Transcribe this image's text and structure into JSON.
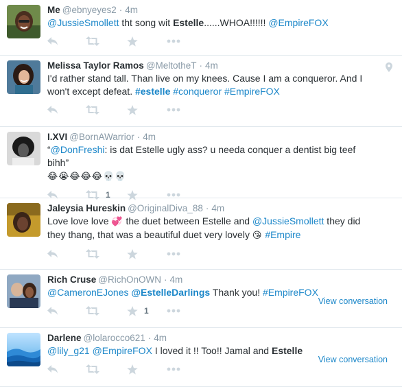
{
  "tweets": [
    {
      "fullname": "Me",
      "username": "@ebnyeyes2",
      "time": "4m",
      "parts": [
        {
          "t": "@JussieSmollett",
          "k": "mention"
        },
        {
          "t": " tht song wit "
        },
        {
          "t": "Estelle",
          "k": "bold"
        },
        {
          "t": "......WHOA!!!!!! "
        },
        {
          "t": "@EmpireFOX",
          "k": "mention"
        }
      ],
      "retweet_count": "",
      "favorite_count": "",
      "view_conversation": "",
      "avatar_icon": "user-photo"
    },
    {
      "fullname": "Melissa Taylor Ramos",
      "username": "@MeltotheT",
      "time": "4m",
      "parts": [
        {
          "t": "I'd rather stand tall.  Than live on my knees. Cause I am a conqueror. And I won't except defeat. "
        },
        {
          "t": "#estelle",
          "k": "hashtag-bold"
        },
        {
          "t": " "
        },
        {
          "t": "#conqueror",
          "k": "hashtag"
        },
        {
          "t": " "
        },
        {
          "t": "#EmpireFOX",
          "k": "hashtag"
        }
      ],
      "retweet_count": "",
      "favorite_count": "",
      "view_conversation": "",
      "avatar_icon": "user-photo",
      "geo_icon": "map-pin-icon"
    },
    {
      "fullname": "I.XVI",
      "username": "@BornAWarrior",
      "time": "4m",
      "parts": [
        {
          "t": "“"
        },
        {
          "t": "@DonFreshi",
          "k": "mention"
        },
        {
          "t": ": is dat Estelle ugly ass? u needa conquer a dentist big teef bihh”"
        },
        {
          "t": "\n"
        },
        {
          "t": "😂😭😂😂😂💀💀",
          "k": "emoji"
        }
      ],
      "retweet_count": "1",
      "favorite_count": "",
      "view_conversation": "",
      "avatar_icon": "user-photo"
    },
    {
      "fullname": "Jaleysia Hureskin",
      "username": "@OriginalDiva_88",
      "time": "4m",
      "parts": [
        {
          "t": "Love love love "
        },
        {
          "t": "💞",
          "k": "emoji"
        },
        {
          "t": " the duet between Estelle and "
        },
        {
          "t": "@JussieSmollett",
          "k": "mention"
        },
        {
          "t": " they did they thang, that was a beautiful duet very lovely "
        },
        {
          "t": "😘",
          "k": "emoji"
        },
        {
          "t": " "
        },
        {
          "t": "#Empire",
          "k": "hashtag"
        }
      ],
      "retweet_count": "",
      "favorite_count": "",
      "view_conversation": "",
      "avatar_icon": "user-photo"
    },
    {
      "fullname": "Rich Cruse",
      "username": "@RichOnOWN",
      "time": "4m",
      "parts": [
        {
          "t": "@CameronEJones",
          "k": "mention"
        },
        {
          "t": " "
        },
        {
          "t": "@EstelleDarlings",
          "k": "mention-bold"
        },
        {
          "t": " Thank you! "
        },
        {
          "t": "#EmpireFOX",
          "k": "hashtag"
        }
      ],
      "retweet_count": "",
      "favorite_count": "1",
      "view_conversation": "View conversation",
      "avatar_icon": "user-photo"
    },
    {
      "fullname": "Darlene",
      "username": "@lolarocco621",
      "time": "4m",
      "parts": [
        {
          "t": "@lily_g21",
          "k": "mention"
        },
        {
          "t": " "
        },
        {
          "t": "@EmpireFOX",
          "k": "mention"
        },
        {
          "t": " I loved it !! Too!! Jamal and "
        },
        {
          "t": "Estelle",
          "k": "bold"
        }
      ],
      "retweet_count": "",
      "favorite_count": "",
      "view_conversation": "View conversation",
      "avatar_icon": "landscape-photo"
    }
  ],
  "separator": "·",
  "colors": {
    "link": "#1c87c9",
    "meta": "#8899a6",
    "action_icon": "#ccd6dd",
    "divider": "#e1e8ed"
  }
}
